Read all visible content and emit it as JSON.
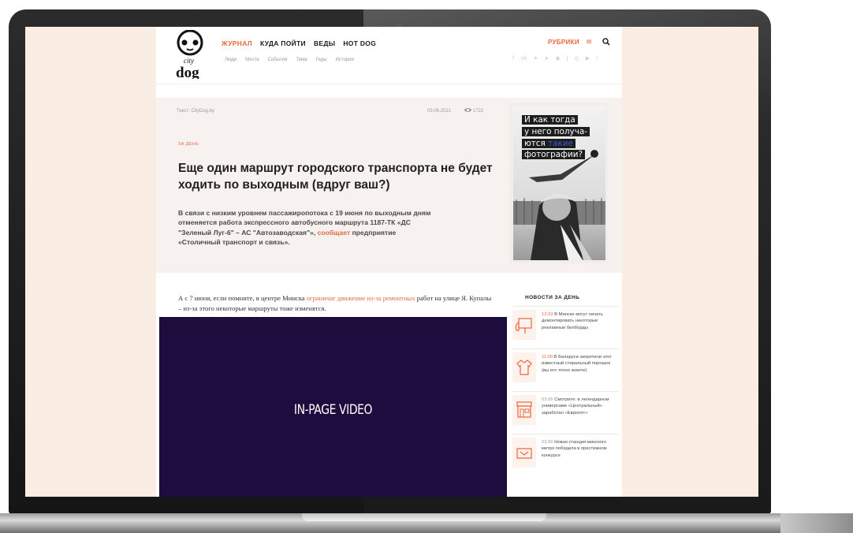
{
  "header": {
    "nav_main": [
      "ЖУРНАЛ",
      "КУДА ПОЙТИ",
      "ВЕДЫ",
      "HOT DOG"
    ],
    "nav_sub": [
      "Люди",
      "Места",
      "События",
      "Тема",
      "Гиды",
      "История"
    ],
    "rubriki": "РУБРИКИ",
    "social_icons": [
      "facebook-icon",
      "vk-icon",
      "twitter-icon",
      "telegram-icon",
      "ok-icon",
      "instagram-icon",
      "youtube-icon",
      "rss-icon"
    ]
  },
  "article": {
    "byline": "Текст: CityDog.by",
    "date": "03.06.2021",
    "views": "1722",
    "category": "ЗА ДЕНЬ",
    "title": "Еще один маршрут городского транспорта не будет ходить по выходным (вдруг ваш?)",
    "lead_before": "В связи с низким уровнем пассажиропотока с 19 июня по выходным дням отменяется работа экспрессного автобусного маршрута 1187-ТК «ДС \"Зеленый Луг-6\" – АС \"Автозаводская\"», ",
    "lead_link": "сообщает",
    "lead_after": " предприятие «Столичный транспорт и связь».",
    "body_before": "А с 7 июня, если помните, в центре Минска ",
    "body_link": "ограничат движение из-за ремонтных",
    "body_after": " работ на улице Я. Купалы – из-за этого некоторые маршруты тоже изменятся."
  },
  "ad": {
    "line1": "И как тогда",
    "line2": "у него получа-",
    "line3_before": "ются ",
    "line3_blue": "такие",
    "line4": "фотографии?"
  },
  "video": {
    "label": "IN-PAGE VIDEO"
  },
  "news": {
    "title": "НОВОСТИ ЗА ДЕНЬ",
    "items": [
      {
        "time": "13:33",
        "text": "В Минске могут начать демонтировать некоторые рекламные билборды",
        "icon": "billboard-hand-icon",
        "highlight": true
      },
      {
        "time": "11:00",
        "text": "В Беларуси запретили этот известный стиральный порошок (вы его точно знаете)",
        "icon": "tshirt-icon",
        "highlight": true
      },
      {
        "time": "03.06",
        "text": "Смотрите: в легендарном универсаме «Центральный» заработал «Евроопт»",
        "icon": "store-icon",
        "highlight": false
      },
      {
        "time": "03.06",
        "text": "Новая станция минского метро победила в престижном конкурсе",
        "icon": "metro-ticket-icon",
        "highlight": false
      }
    ]
  },
  "colors": {
    "accent": "#e8683f",
    "video_bg": "#1d0c3d",
    "screen_bg": "#faeee4"
  }
}
